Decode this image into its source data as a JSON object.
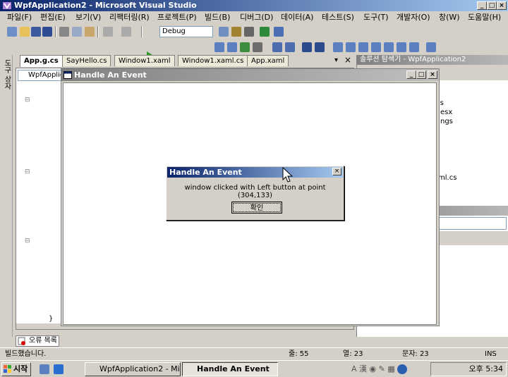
{
  "app": {
    "title": "WpfApplication2 - Microsoft Visual Studio"
  },
  "menu": [
    "파일(F)",
    "편집(E)",
    "보기(V)",
    "리팩터링(R)",
    "프로젝트(P)",
    "빌드(B)",
    "디버그(D)",
    "데이터(A)",
    "테스트(S)",
    "도구(T)",
    "개발자(O)",
    "창(W)",
    "도움말(H)"
  ],
  "toolbar": {
    "config_value": "Debug"
  },
  "tabs": [
    "App.g.cs",
    "SayHello.cs",
    "Window1.xaml",
    "Window1.xaml.cs",
    "App.xaml"
  ],
  "left_strip_label": "도구 상자",
  "editor": {
    "dropdown_text": "WpfApplic",
    "closing_brace": "}"
  },
  "wpf_window": {
    "title": "Handle An Event"
  },
  "solution_explorer": {
    "title": "솔루션 탐색기 - WpfApplication2",
    "items": [
      "o.cs",
      "esx",
      "ngs",
      "ml.cs"
    ]
  },
  "message_box": {
    "title": "Handle An Event",
    "text": "window clicked with Left button at point (304,133)",
    "ok_label": "확인"
  },
  "error_list_tab": "오류 목록",
  "statusbar": {
    "message": "빌드했습니다.",
    "line": "줄: 55",
    "col": "열: 23",
    "char": "문자: 23",
    "mode": "INS"
  },
  "taskbar": {
    "start_label": "시작",
    "buttons": [
      "WpfApplication2 - Mi...",
      "Handle An Event"
    ],
    "clock": "오후 5:34"
  }
}
